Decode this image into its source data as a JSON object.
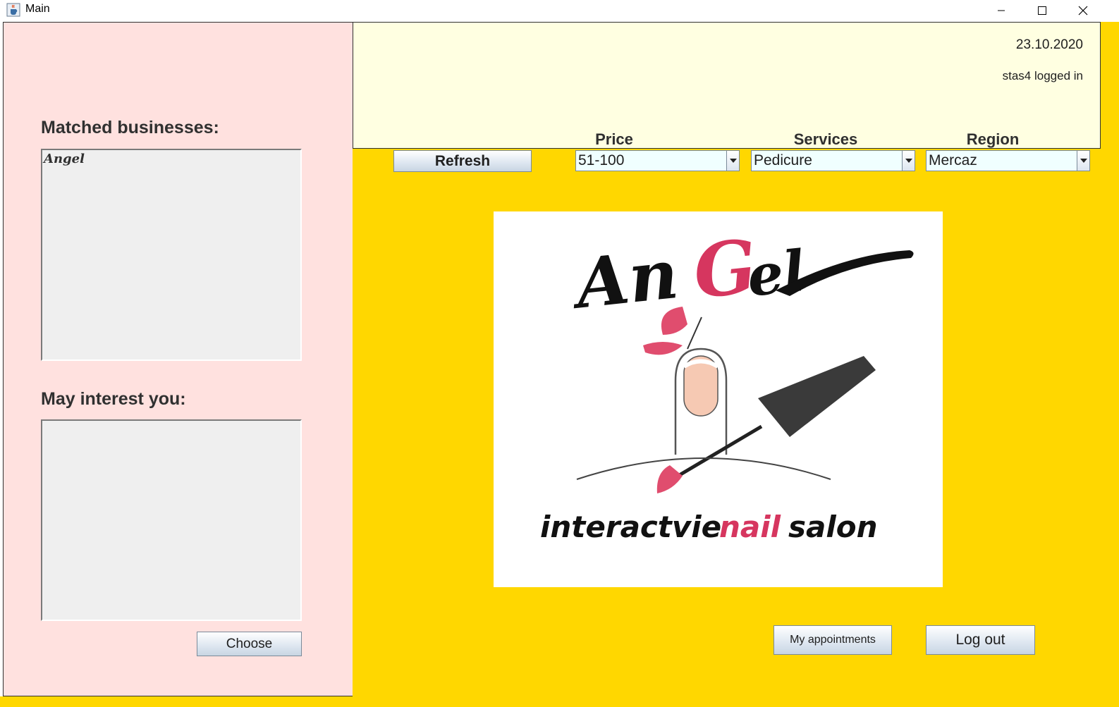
{
  "window": {
    "title": "Main",
    "icon": "java-cup-icon",
    "controls": [
      "minimize-icon",
      "maximize-icon",
      "close-icon"
    ]
  },
  "sidebar": {
    "matched_heading": "Matched businesses:",
    "matched_items": [
      "Angel"
    ],
    "interest_heading": "May interest you:",
    "interest_items": [],
    "choose_label": "Choose"
  },
  "header": {
    "date": "23.10.2020",
    "login_status": "stas4 logged in"
  },
  "filters": {
    "refresh_label": "Refresh",
    "price_label": "Price",
    "price_value": "51-100",
    "services_label": "Services",
    "services_value": "Pedicure",
    "region_label": "Region",
    "region_value": "Mercaz"
  },
  "logo": {
    "brand_text": "AnGel",
    "tagline_prefix": "interactvie",
    "tagline_accent": "nail",
    "tagline_suffix": "salon",
    "accent_color": "#d6365f"
  },
  "actions": {
    "appointments_label": "My appointments",
    "logout_label": "Log out"
  },
  "colors": {
    "sidebar_bg": "#ffe1df",
    "header_bg": "#ffffe1",
    "main_bg": "#ffd700",
    "list_bg": "#efefef",
    "combo_bg": "#f0ffff"
  }
}
